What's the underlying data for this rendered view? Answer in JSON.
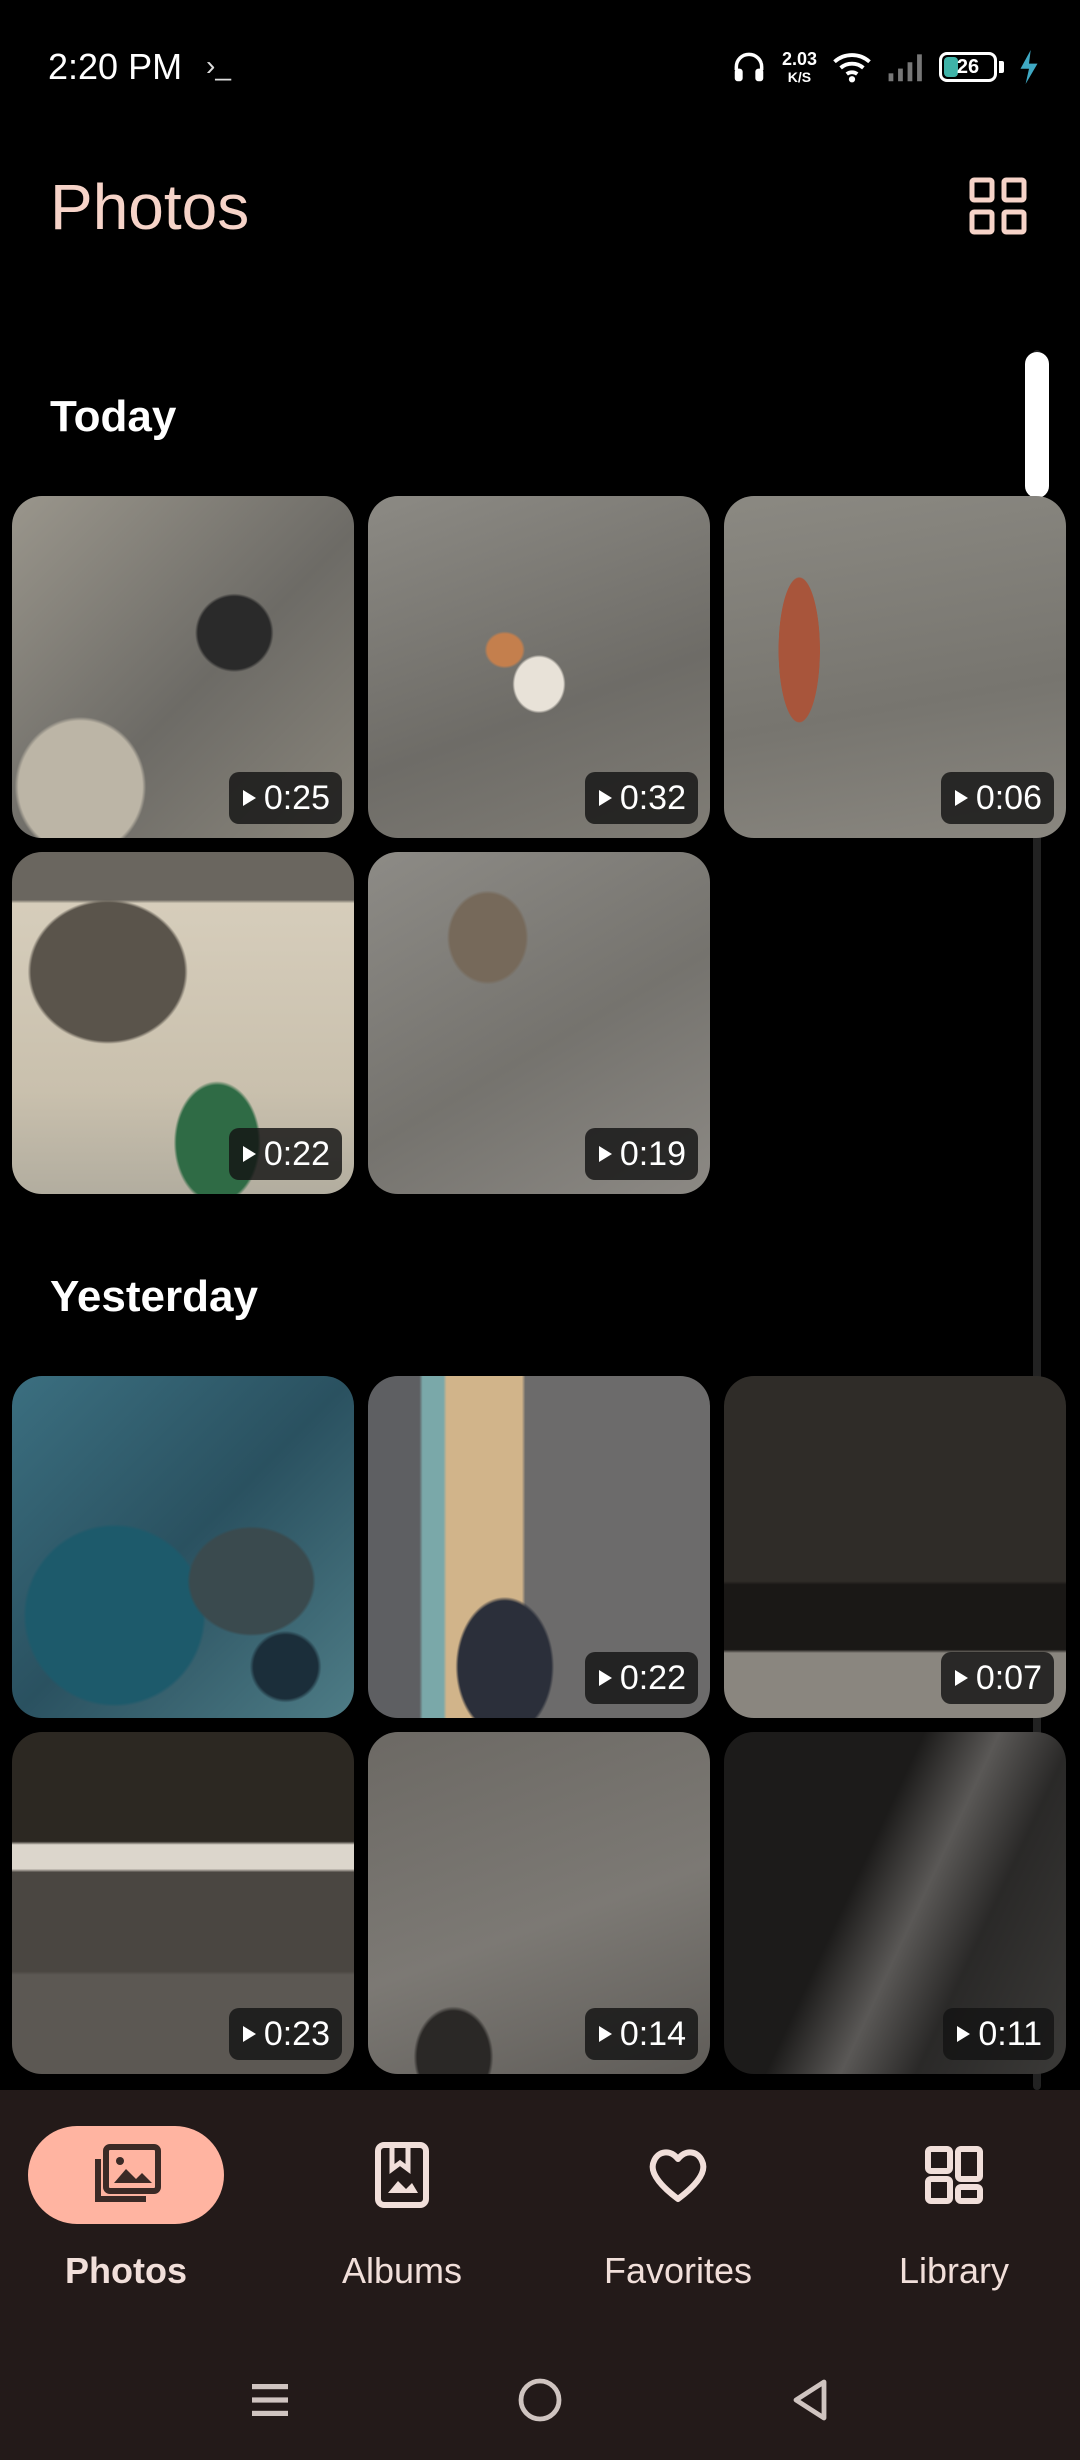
{
  "status_bar": {
    "time": "2:20 PM",
    "speed_value": "2.03",
    "speed_unit": "K/S",
    "battery": "26",
    "battery_level": 0.26,
    "icons": [
      "headphones-icon",
      "wifi-icon",
      "signal-icon",
      "battery-icon",
      "charging-icon"
    ]
  },
  "header": {
    "title": "Photos",
    "view_icon": "grid-view-icon"
  },
  "sections": [
    {
      "title": "Today",
      "items": [
        {
          "duration": "0:25",
          "scene": "concrete floor with black sandals and cat"
        },
        {
          "duration": "0:32",
          "scene": "white and orange cat lying on concrete"
        },
        {
          "duration": "0:06",
          "scene": "blurred cat on concrete floor"
        },
        {
          "duration": "0:22",
          "scene": "tabby cat near green patterned tiles"
        },
        {
          "duration": "0:19",
          "scene": "tabby cat on concrete floor"
        }
      ]
    },
    {
      "title": "Yesterday",
      "items": [
        {
          "duration": "",
          "scene": "mobile game battle screen"
        },
        {
          "duration": "0:22",
          "scene": "shooter game screen with soldier"
        },
        {
          "duration": "0:07",
          "scene": "dark blurred wall edge"
        },
        {
          "duration": "0:23",
          "scene": "night ground with white wall edge"
        },
        {
          "duration": "0:14",
          "scene": "blurred grey ground"
        },
        {
          "duration": "0:11",
          "scene": "dark blurred floor"
        }
      ]
    }
  ],
  "bottom_nav": {
    "items": [
      {
        "label": "Photos",
        "icon": "photos-icon",
        "active": true
      },
      {
        "label": "Albums",
        "icon": "albums-icon",
        "active": false
      },
      {
        "label": "Favorites",
        "icon": "heart-icon",
        "active": false
      },
      {
        "label": "Library",
        "icon": "library-icon",
        "active": false
      }
    ]
  },
  "system_nav": [
    "menu-icon",
    "home-icon",
    "back-icon"
  ],
  "colors": {
    "accent": "#ffb4a1",
    "title": "#f6d3c8",
    "nav_bg": "#231a19",
    "background": "#000000"
  }
}
